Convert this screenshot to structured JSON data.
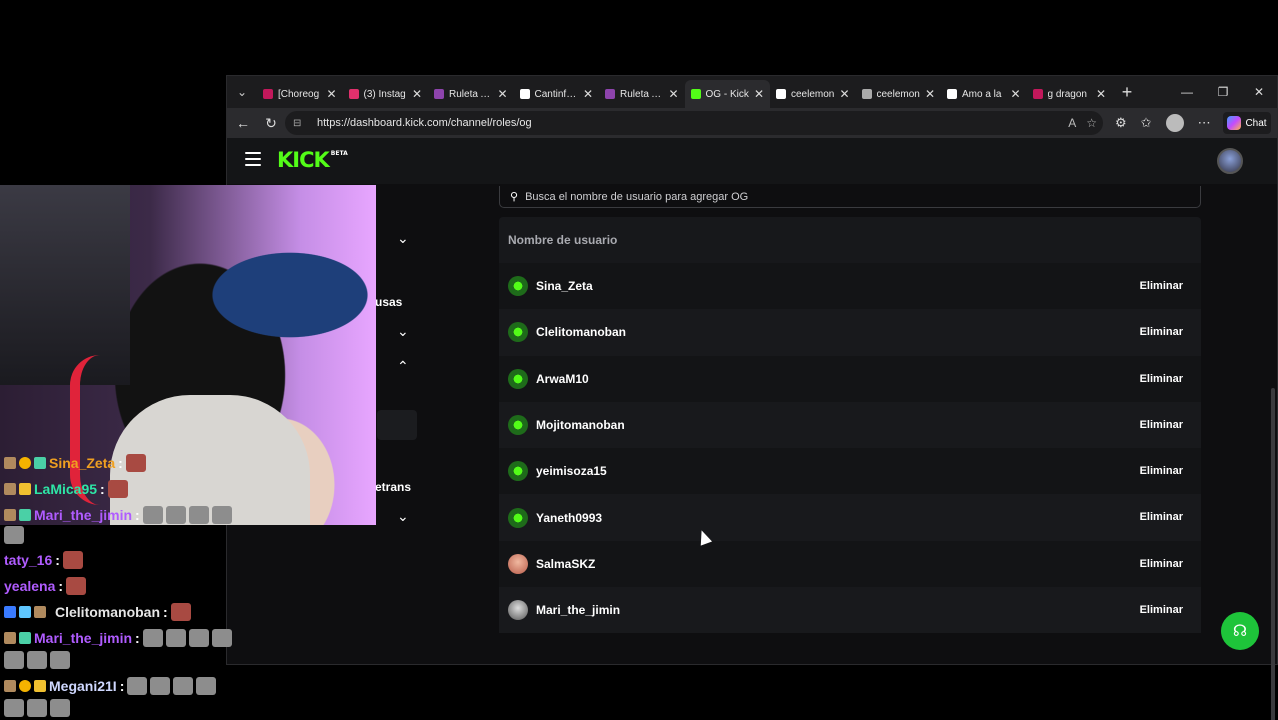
{
  "browser": {
    "tabs": [
      {
        "label": "[Choreog",
        "color": "#c2185b"
      },
      {
        "label": "(3) Instag",
        "color": "#e1306c"
      },
      {
        "label": "Ruleta Ale",
        "color": "#8e44ad"
      },
      {
        "label": "Cantinflas",
        "color": "#ffffff"
      },
      {
        "label": "Ruleta Ale",
        "color": "#8e44ad"
      },
      {
        "label": "OG - Kick",
        "color": "#53fc18",
        "active": true
      },
      {
        "label": "ceelemon",
        "color": "#ffffff"
      },
      {
        "label": "ceelemon",
        "color": "#aaaaaa"
      },
      {
        "label": "Amo a la",
        "color": "#ffffff"
      },
      {
        "label": "g dragon",
        "color": "#c2185b"
      }
    ],
    "url": "https://dashboard.kick.com/channel/roles/og",
    "chat_label": "Chat"
  },
  "kick": {
    "logo_text": "KICK",
    "logo_badge": "BETA",
    "sidebar_partial": [
      "usas",
      "etrans"
    ],
    "search_placeholder": "Busca el nombre de usuario para agregar OG",
    "column_header": "Nombre de usuario",
    "delete_label": "Eliminar",
    "users": [
      {
        "name": "Sina_Zeta",
        "avatar": "green"
      },
      {
        "name": "Clelitomanoban",
        "avatar": "green"
      },
      {
        "name": "ArwaM10",
        "avatar": "green"
      },
      {
        "name": "Mojitomanoban",
        "avatar": "green"
      },
      {
        "name": "yeimisoza15",
        "avatar": "green"
      },
      {
        "name": "Yaneth0993",
        "avatar": "green"
      },
      {
        "name": "SalmaSKZ",
        "avatar": "photo1"
      },
      {
        "name": "Mari_the_jimin",
        "avatar": "photo2"
      }
    ]
  },
  "chat": {
    "messages": [
      {
        "user": "Sina_Zeta",
        "color": "#f0a020"
      },
      {
        "user": "LaMica95",
        "color": "#2ee6a6"
      },
      {
        "user": "Mari_the_jimin",
        "color": "#b05cff"
      },
      {
        "user": "taty_16",
        "color": "#b05cff"
      },
      {
        "user": "yealena",
        "color": "#b05cff"
      },
      {
        "user": "Clelitomanoban",
        "color": "#e6e6e6"
      },
      {
        "user": "Mari_the_jimin",
        "color": "#b05cff"
      },
      {
        "user": "Megani21I",
        "color": "#cfd8ff"
      }
    ],
    "colon": ":"
  }
}
